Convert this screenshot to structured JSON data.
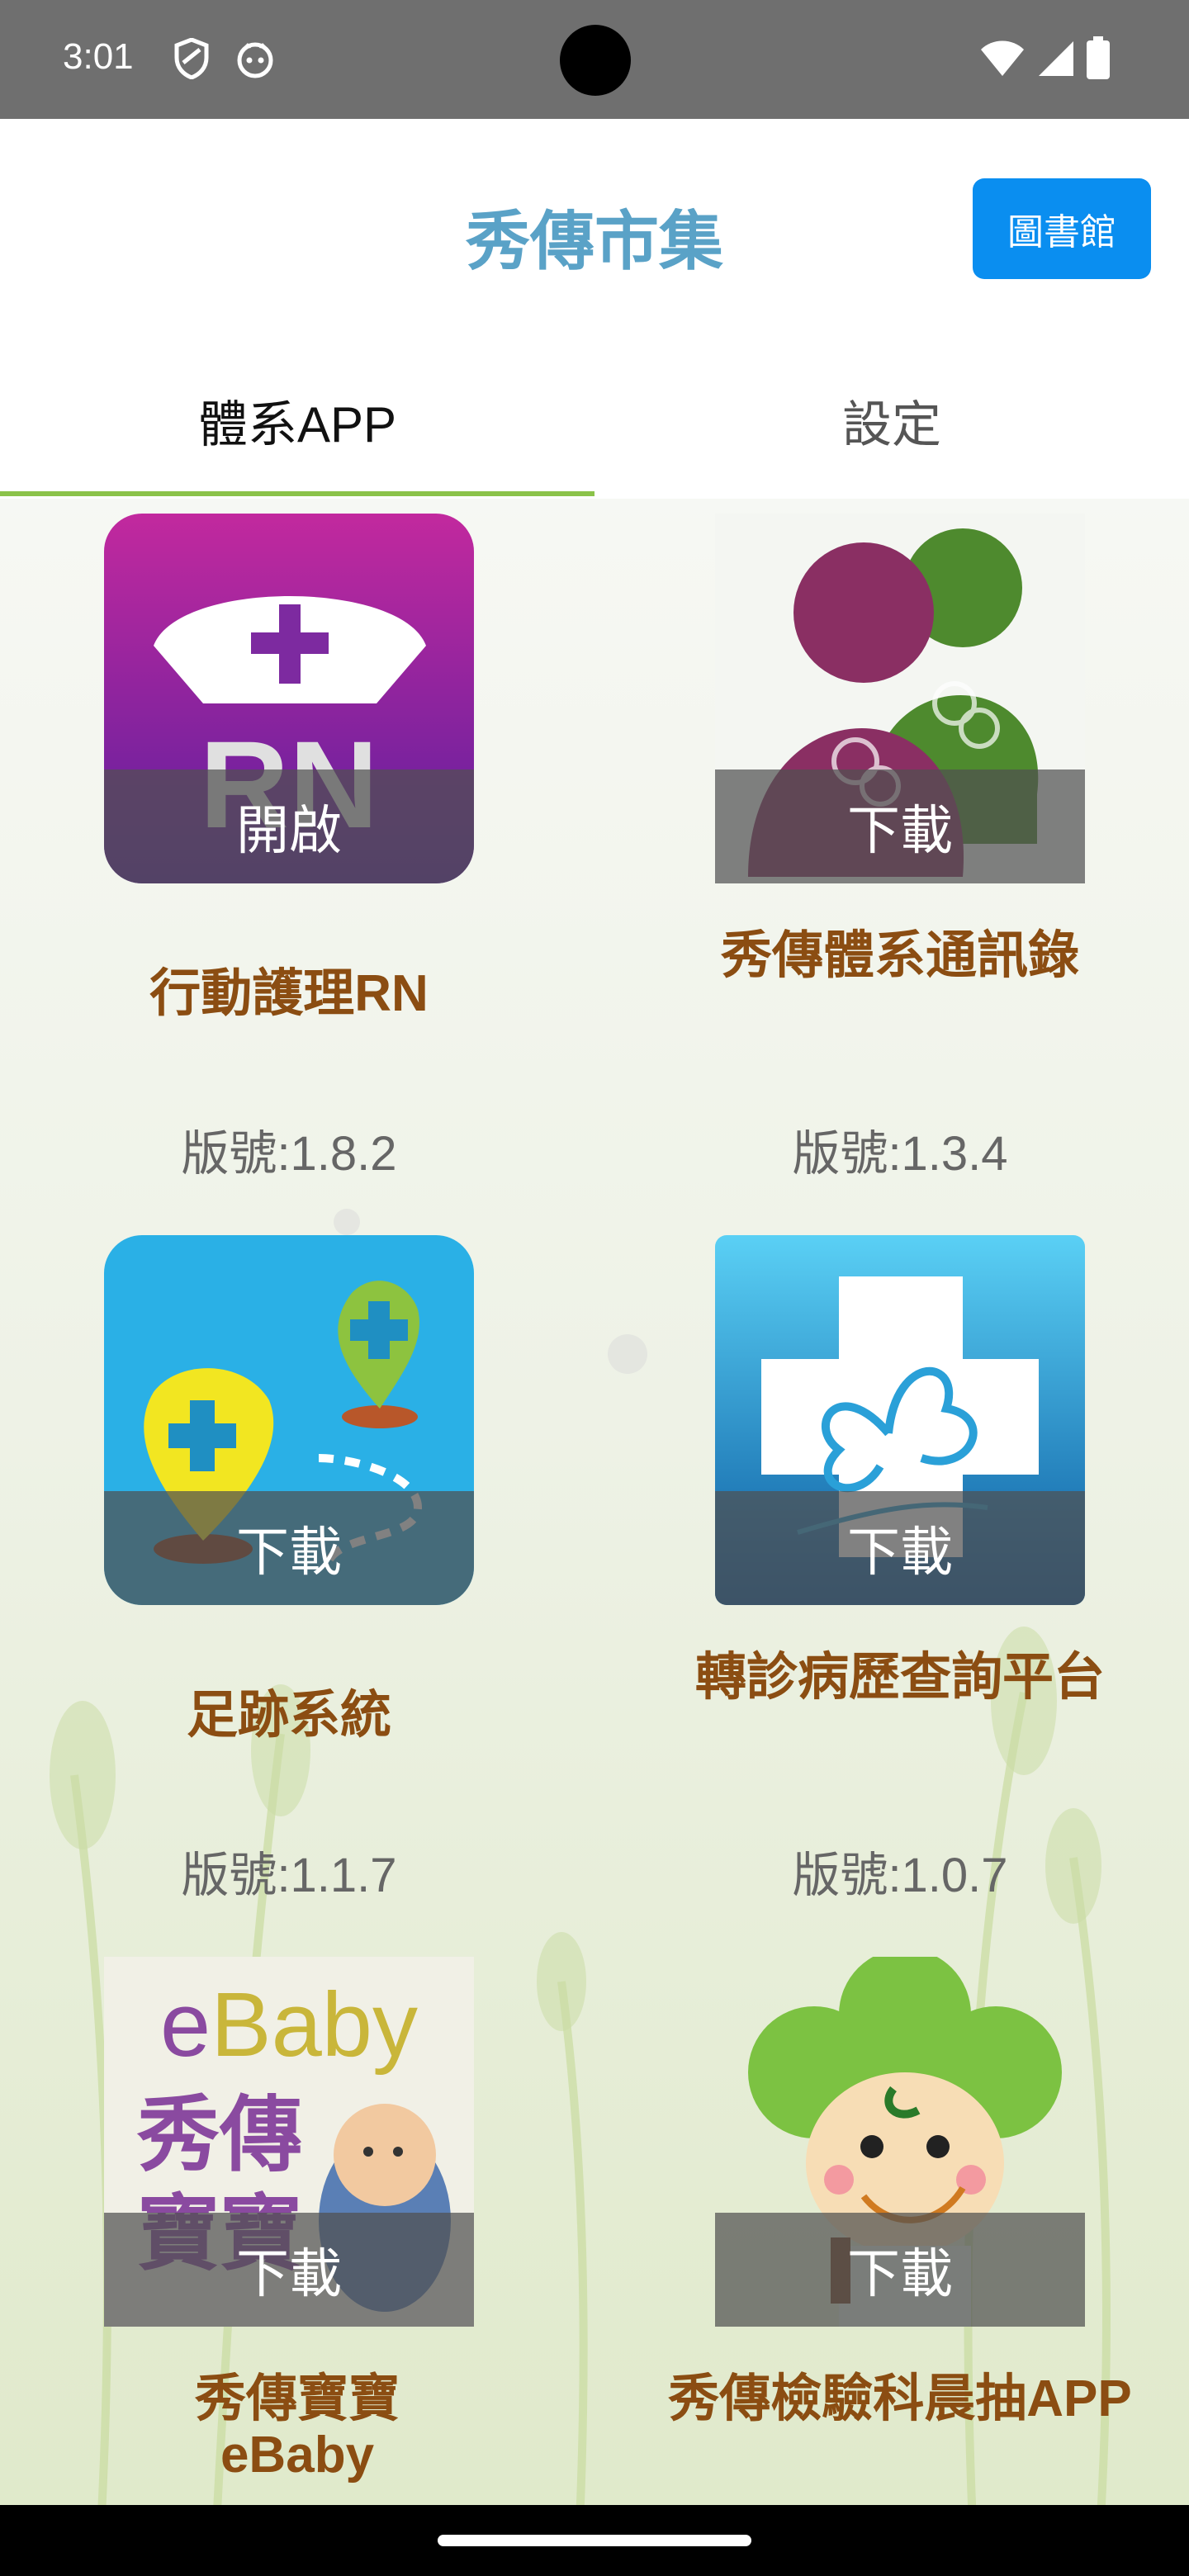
{
  "status_bar": {
    "time": "3:01"
  },
  "header": {
    "title": "秀傳市集",
    "library_button": "圖書館"
  },
  "tabs": [
    {
      "label": "體系APP",
      "active": true
    },
    {
      "label": "設定",
      "active": false
    }
  ],
  "colors": {
    "accent": "#8bc34a",
    "title": "#5aa2c7",
    "app_name": "#8b4d12",
    "button": "#0a8ef0"
  },
  "apps": [
    {
      "name": "行動護理RN",
      "version": "版號:1.8.2",
      "action": "開啟",
      "icon": "nurse-rn-icon"
    },
    {
      "name": "秀傳體系通訊錄",
      "version": "版號:1.3.4",
      "action": "下載",
      "icon": "contacts-people-icon"
    },
    {
      "name": "足跡系統",
      "version": "版號:1.1.7",
      "action": "下載",
      "icon": "footprint-map-pin-icon"
    },
    {
      "name": "轉診病歷查詢平台",
      "version": "版號:1.0.7",
      "action": "下載",
      "icon": "medical-cross-clover-icon"
    },
    {
      "name": "秀傳寶寶eBaby",
      "version": "",
      "action": "下載",
      "icon": "ebaby-icon",
      "icon_text": "eBaby"
    },
    {
      "name": "秀傳檢驗科晨抽APP",
      "version": "",
      "action": "下載",
      "icon": "clover-mascot-icon"
    }
  ]
}
